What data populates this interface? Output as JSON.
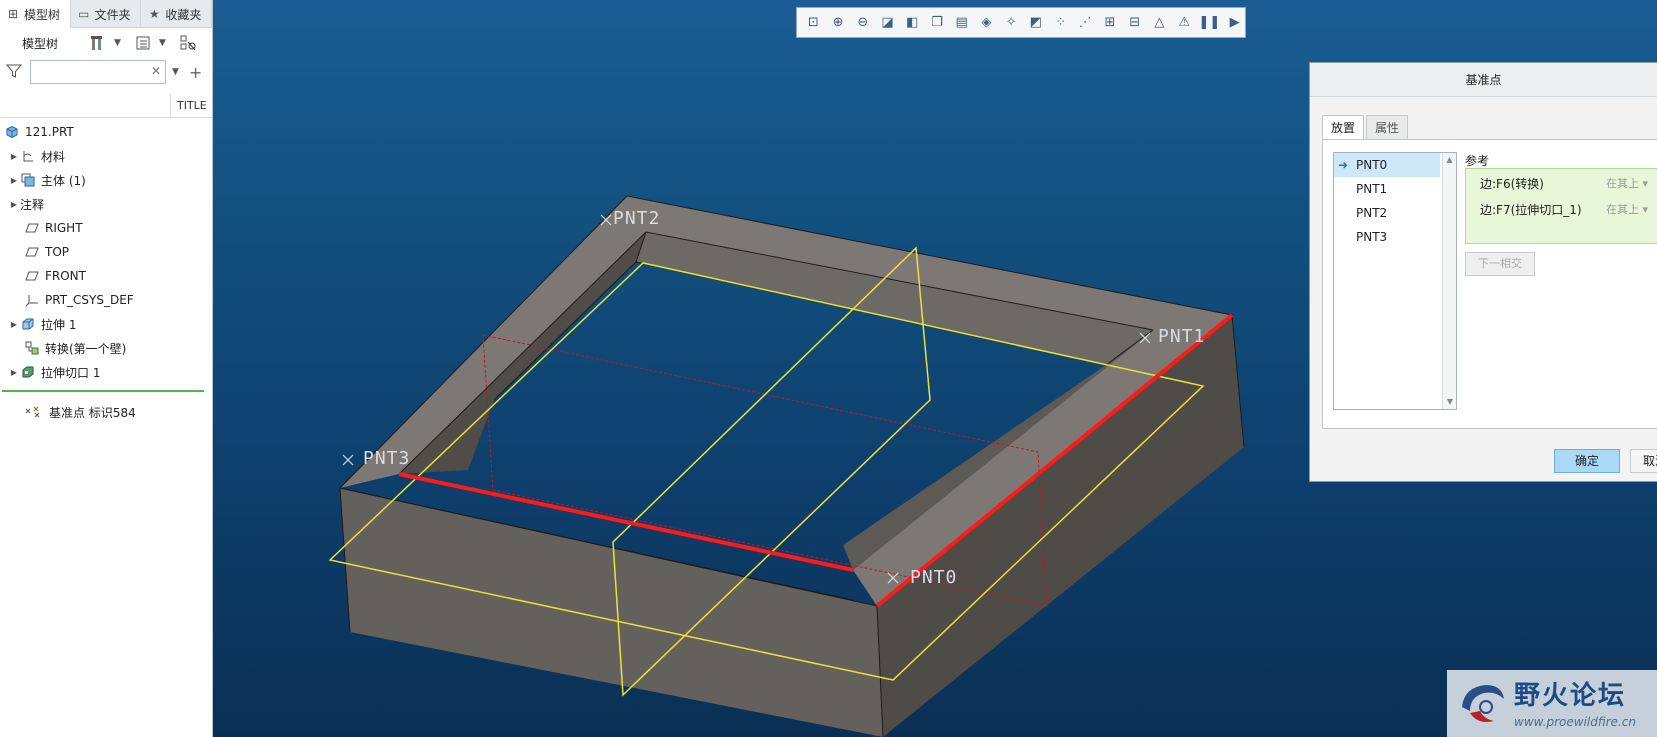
{
  "panel": {
    "tabs": [
      {
        "label": "模型树",
        "icon": "tree-icon"
      },
      {
        "label": "文件夹",
        "icon": "folder-icon"
      },
      {
        "label": "收藏夹",
        "icon": "favorites-icon"
      }
    ],
    "toolbar_label": "模型树",
    "search": {
      "value": "",
      "placeholder": ""
    },
    "column_title": "TITLE"
  },
  "tree": {
    "items": [
      {
        "label": "121.PRT",
        "icon": "part-icon",
        "expandable": false,
        "indent": 0
      },
      {
        "label": "材料",
        "icon": "material-icon",
        "expandable": true,
        "indent": 1
      },
      {
        "label": "主体 (1)",
        "icon": "body-icon",
        "expandable": true,
        "indent": 1
      },
      {
        "label": "注释",
        "icon": "annotation-icon",
        "expandable": true,
        "indent": 1
      },
      {
        "label": "RIGHT",
        "icon": "datum-plane-icon",
        "expandable": false,
        "indent": 1
      },
      {
        "label": "TOP",
        "icon": "datum-plane-icon",
        "expandable": false,
        "indent": 1
      },
      {
        "label": "FRONT",
        "icon": "datum-plane-icon",
        "expandable": false,
        "indent": 1
      },
      {
        "label": "PRT_CSYS_DEF",
        "icon": "csys-icon",
        "expandable": false,
        "indent": 1
      },
      {
        "label": "拉伸 1",
        "icon": "extrude-icon",
        "expandable": true,
        "indent": 1
      },
      {
        "label": "转换(第一个壁)",
        "icon": "convert-icon",
        "expandable": false,
        "indent": 1
      },
      {
        "label": "拉伸切口 1",
        "icon": "extrude-cut-icon",
        "expandable": true,
        "indent": 1
      }
    ],
    "insert_item": {
      "label": "基准点 标识584",
      "icon": "datum-point-icon"
    }
  },
  "viewport": {
    "point_labels": [
      "PNT2",
      "PNT1",
      "PNT3",
      "PNT0"
    ]
  },
  "graphics_toolbar": {
    "buttons": [
      "refit-icon",
      "zoom-in-icon",
      "zoom-out-icon",
      "repaint-icon",
      "display-style-icon",
      "saved-views-icon",
      "view-manager-icon",
      "perspective-icon",
      "spin-center-icon",
      "annotation-display-icon",
      "datum-display-icon",
      "point-display-icon",
      "csys-display-icon",
      "plane-display-icon",
      "appearance-icon",
      "simulation-icon",
      "pause-icon",
      "next-icon"
    ]
  },
  "dialog": {
    "title": "基准点",
    "tabs": [
      "放置",
      "属性"
    ],
    "points": [
      "PNT0",
      "PNT1",
      "PNT2",
      "PNT3"
    ],
    "selected_point": "PNT0",
    "reference_label": "参考",
    "references": [
      {
        "ref": "边:F6(转换)",
        "constraint": "在其上"
      },
      {
        "ref": "边:F7(拉伸切口_1)",
        "constraint": "在其上"
      }
    ],
    "next_intersect_label": "下一相交",
    "ok_label": "确定",
    "cancel_label": "取消"
  },
  "watermark": {
    "name": "野火论坛",
    "url": "www.proewildfire.cn"
  },
  "colors": {
    "viewport_top": "#1a5d94",
    "viewport_bottom": "#0a2f54",
    "model_top": "#7b7670",
    "model_side": "#58544f",
    "datum_plane": "#e8e23a",
    "highlight_edge": "#ff1a1a",
    "ok_button": "#a9d9f5"
  }
}
